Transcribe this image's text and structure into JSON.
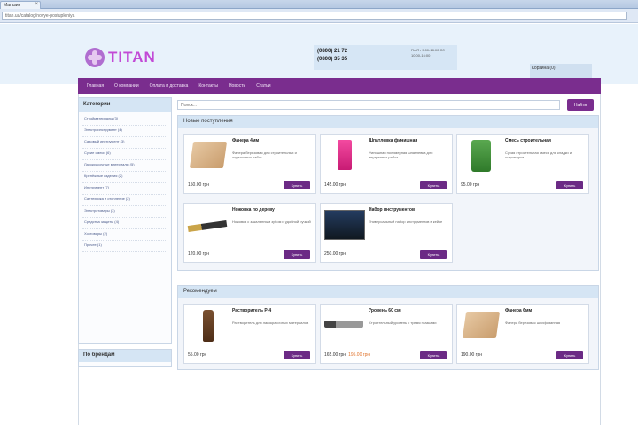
{
  "browser": {
    "tab_title": "Магазин",
    "tab_close": "×",
    "url": "titan.ua/catalog/novye-postupleniya"
  },
  "header": {
    "logo_text": "TITAN",
    "phones": [
      "(0800) 21 72",
      "(0800) 35 35"
    ],
    "phone_note": "Пн-Пт 9:00-18:00 Сб 10:00-16:00",
    "account_link": "Корзина (0)"
  },
  "nav": {
    "items": [
      "Главная",
      "О компании",
      "Оплата и доставка",
      "Контакты",
      "Новости",
      "Статьи"
    ]
  },
  "sidebar": {
    "title": "Категории",
    "items": [
      "Стройматериалы (3)",
      "Электроинструмент (4)",
      "Садовый инструмент (3)",
      "Сухие смеси (6)",
      "Лакокрасочные материалы (5)",
      "Крепёжные изделия (2)",
      "Инструмент (7)",
      "Сантехника и отопление (2)",
      "Электротовары (3)",
      "Средства защиты (4)",
      "Хозтовары (2)",
      "Прочее (1)"
    ],
    "second_title": "По брендам"
  },
  "search": {
    "placeholder": "Поиск...",
    "button_label": "Найти"
  },
  "sections": {
    "new_title": "Новые поступления",
    "rec_title": "Рекомендуем"
  },
  "products_new": [
    {
      "name": "Фанера 4мм",
      "desc": "Фанера березовая для строительных и отделочных работ",
      "price": "150.00 грн",
      "btn": "Купить",
      "img": "box"
    },
    {
      "name": "Шпатлевка финишная",
      "desc": "Финишная полимерная шпатлевка для внутренних работ",
      "price": "145.00 грн",
      "btn": "Купить",
      "img": "pink"
    },
    {
      "name": "Смесь строительная",
      "desc": "Сухая строительная смесь для кладки и штукатурки",
      "price": "95.00 грн",
      "btn": "Купить",
      "img": "bag"
    },
    {
      "name": "Ножовка по дереву",
      "desc": "Ножовка с закаленным зубом и удобной ручкой",
      "price": "120.00 грн",
      "btn": "Купить",
      "img": "saw"
    },
    {
      "name": "Набор инструментов",
      "desc": "Универсальный набор инструментов в кейсе",
      "price": "250.00 грн",
      "btn": "Купить",
      "img": "dark"
    }
  ],
  "products_rec": [
    {
      "name": "Растворитель Р-4",
      "desc": "Растворитель для лакокрасочных материалов",
      "price": "55.00 грн",
      "old_price": "",
      "btn": "Купить",
      "img": "bottle"
    },
    {
      "name": "Уровень 60 см",
      "desc": "Строительный уровень с тремя глазками",
      "price": "165.00 грн",
      "old_price": "195.00 грн",
      "btn": "Купить",
      "img": "tool"
    },
    {
      "name": "Фанера 6мм",
      "desc": "Фанера березовая шлифованная",
      "price": "190.00 грн",
      "old_price": "",
      "btn": "Купить",
      "img": "box"
    }
  ],
  "colors": {
    "brand_purple": "#7a2d8e",
    "header_bg": "#e8f2fb",
    "section_header": "#d5e5f4",
    "logo_pink": "#c24ad6"
  }
}
